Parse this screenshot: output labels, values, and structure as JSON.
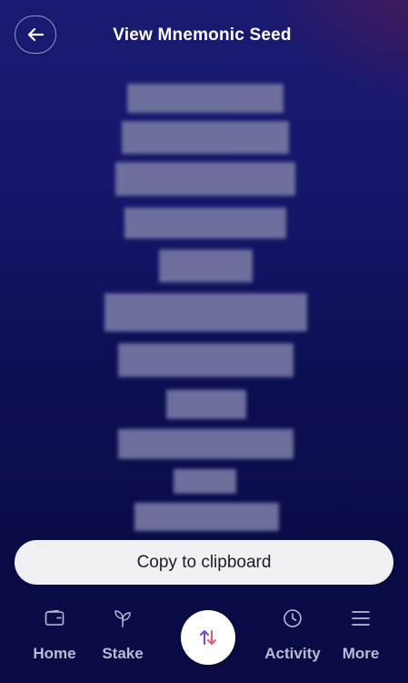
{
  "header": {
    "title": "View Mnemonic Seed",
    "back_icon": "arrow-left-icon"
  },
  "copy_button": {
    "label": "Copy to clipboard"
  },
  "nav": {
    "home_label": "Home",
    "stake_label": "Stake",
    "activity_label": "Activity",
    "more_label": "More",
    "swap_icon": "swap-arrows-icon"
  },
  "colors": {
    "background_top": "#1a1a72",
    "background_bottom": "#0a0c46",
    "accent_glow": "#6e1c48",
    "blur_word": "#6e6f9c",
    "swap_up_arrow": "#7b3fe4",
    "swap_down_arrow": "#e8507a"
  }
}
